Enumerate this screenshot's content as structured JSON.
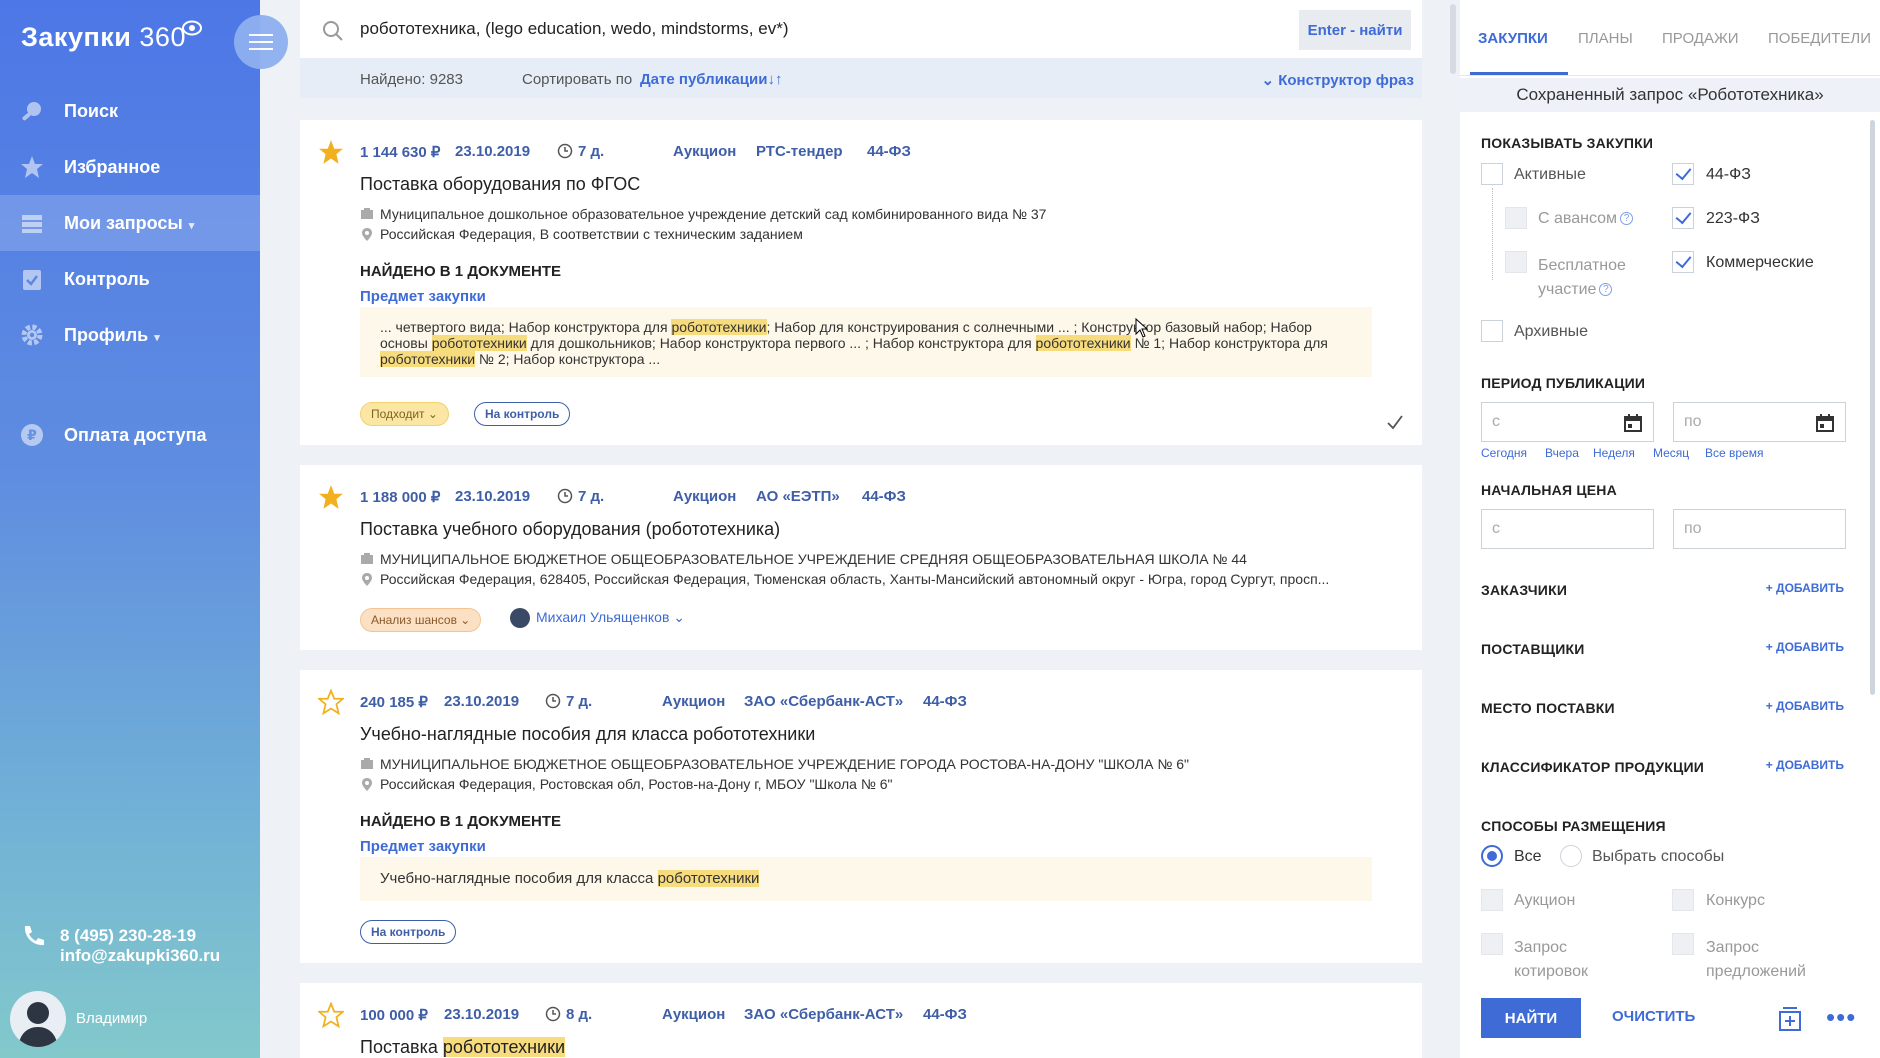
{
  "sidebar": {
    "logo_text": "Закупки",
    "logo_num": "360",
    "nav": [
      {
        "label": "Поиск"
      },
      {
        "label": "Избранное"
      },
      {
        "label": "Мои запросы",
        "caret": "▾"
      },
      {
        "label": "Контроль"
      },
      {
        "label": "Профиль",
        "caret": "▾"
      }
    ],
    "payment": "Оплата доступа",
    "phone": "8 (495) 230-28-19",
    "email": "info@zakupki360.ru",
    "user_name": "Владимир"
  },
  "search": {
    "query": "робототехника, (lego education, wedo, mindstorms, ev*)",
    "button": "Enter - найти",
    "found": "Найдено: 9283",
    "sort_label": "Сортировать по",
    "sort_value": "Дате публикации↓↑",
    "constructor": "⌄ Конструктор фраз"
  },
  "cards": [
    {
      "price": "1 144 630 ₽",
      "date": "23.10.2019",
      "days": "7 д.",
      "type": "Аукцион",
      "platform": "РТС-тендер",
      "law": "44-ФЗ",
      "title": "Поставка оборудования по ФГОС",
      "org": "Муниципальное дошкольное образовательное учреждение детский сад комбинированного вида № 37",
      "place": "Российская Федерация, В соответствии с техническим заданием",
      "found_in": "НАЙДЕНО В 1 ДОКУМЕНТЕ",
      "subject": "Предмет закупки",
      "snippet_a": "... четвертого вида; Набор конструктора для ",
      "snippet_b": "; Набор для конструирования с солнечными ... ; Конструктор базовый набор; Набор основы ",
      "snippet_c": " для дошкольников; Набор конструктора первого ... ; Набор конструктора для ",
      "snippet_d": " № 1; Набор конструктора для ",
      "snippet_e": " № 2; Набор конструктора ...",
      "hl": "робототехники",
      "pill1": "Подходит ⌄",
      "pill2": "На контроль"
    },
    {
      "price": "1 188 000 ₽",
      "date": "23.10.2019",
      "days": "7 д.",
      "type": "Аукцион",
      "platform": "АО «ЕЭТП»",
      "law": "44-ФЗ",
      "title": "Поставка учебного оборудования (робототехника)",
      "org": "МУНИЦИПАЛЬНОЕ БЮДЖЕТНОЕ ОБЩЕОБРАЗОВАТЕЛЬНОЕ УЧРЕЖДЕНИЕ СРЕДНЯЯ ОБЩЕОБРАЗОВАТЕЛЬНАЯ ШКОЛА № 44",
      "place": "Российская Федерация, 628405, Российская Федерация, Тюменская область, Ханты-Мансийский автономный округ - Югра, город Сургут, просп...",
      "pill1": "Анализ шансов ⌄",
      "user": "Михаил Ульященков ⌄"
    },
    {
      "price": "240 185 ₽",
      "date": "23.10.2019",
      "days": "7 д.",
      "type": "Аукцион",
      "platform": "ЗАО «Сбербанк-АСТ»",
      "law": "44-ФЗ",
      "title": "Учебно-наглядные пособия для класса робототехники",
      "org": "МУНИЦИПАЛЬНОЕ БЮДЖЕТНОЕ ОБЩЕОБРАЗОВАТЕЛЬНОЕ УЧРЕЖДЕНИЕ ГОРОДА РОСТОВА-НА-ДОНУ \"ШКОЛА № 6\"",
      "place": "Российская Федерация, Ростовская обл, Ростов-на-Дону г, МБОУ \"Школа № 6\"",
      "found_in": "НАЙДЕНО В 1 ДОКУМЕНТЕ",
      "subject": "Предмет закупки",
      "snippet_a": "Учебно-наглядные пособия для класса ",
      "hl": "робототехники",
      "pill2": "На контроль"
    },
    {
      "price": "100 000 ₽",
      "date": "23.10.2019",
      "days": "8 д.",
      "type": "Аукцион",
      "platform": "ЗАО «Сбербанк-АСТ»",
      "law": "44-ФЗ",
      "title_a": "Поставка ",
      "hl": "робототехники"
    }
  ],
  "panel": {
    "tabs": [
      "ЗАКУПКИ",
      "ПЛАНЫ",
      "ПРОДАЖИ",
      "ПОБЕДИТЕЛИ"
    ],
    "saved": "Сохраненный запрос «Робототехника»",
    "show_head": "ПОКАЗЫВАТЬ ЗАКУПКИ",
    "cb_active": "Активные",
    "cb_advance": "С авансом",
    "cb_free1": "Бесплатное",
    "cb_free2": "участие",
    "cb_archive": "Архивные",
    "cb_44": "44-ФЗ",
    "cb_223": "223-ФЗ",
    "cb_comm": "Коммерческие",
    "q": "?",
    "period_head": "ПЕРИОД ПУБЛИКАЦИИ",
    "from": "с",
    "to": "по",
    "quick": [
      "Сегодня",
      "Вчера",
      "Неделя",
      "Месяц",
      "Все время"
    ],
    "price_head": "НАЧАЛЬНАЯ ЦЕНА",
    "customers": "ЗАКАЗЧИКИ",
    "suppliers": "ПОСТАВЩИКИ",
    "delivery": "МЕСТО ПОСТАВКИ",
    "classifier": "КЛАССИФИКАТОР ПРОДУКЦИИ",
    "add": "+ ДОБАВИТЬ",
    "methods_head": "СПОСОБЫ РАЗМЕЩЕНИЯ",
    "rb_all": "Все",
    "rb_choose": "Выбрать способы",
    "m_auction": "Аукцион",
    "m_contest": "Конкурс",
    "m_quotes1": "Запрос",
    "m_quotes2": "котировок",
    "m_props1": "Запрос",
    "m_props2": "предложений",
    "btn_find": "НАЙТИ",
    "btn_clear": "ОЧИСТИТЬ",
    "more": "•••"
  },
  "colors": {
    "accent": "#3e6bd6",
    "star": "#f2b01e",
    "highlight": "#f7dc7e"
  }
}
